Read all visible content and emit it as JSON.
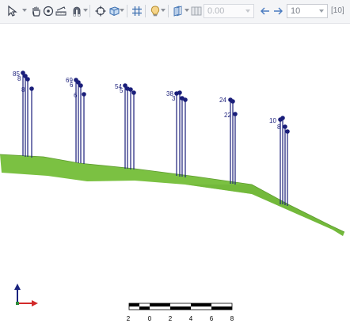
{
  "toolbar": {
    "tools": [
      {
        "name": "select-tool-icon"
      },
      {
        "name": "pan-tool-icon"
      },
      {
        "name": "zoom-target-icon"
      },
      {
        "name": "measure-ruler-icon"
      },
      {
        "name": "magnet-snap-icon"
      },
      {
        "name": "crosshair-center-icon"
      },
      {
        "name": "cube-view-icon"
      },
      {
        "name": "grid-icon"
      },
      {
        "name": "lightbulb-icon"
      },
      {
        "name": "layers-icon"
      },
      {
        "name": "columns-view-icon"
      }
    ],
    "value_input": "0.00",
    "zoom_value": "10",
    "zoom_count": "[10]"
  },
  "scene": {
    "terrain_color": "#7bc142",
    "marker_color": "#1a1e7a",
    "point_labels": [
      "85",
      "69",
      "54",
      "38",
      "24",
      "22",
      "10",
      "8"
    ]
  },
  "axes": {
    "x_color": "#d22a2a",
    "y_color": "#1a237e"
  },
  "scale_bar": {
    "ticks": [
      "2",
      "0",
      "2",
      "4",
      "6",
      "8"
    ]
  }
}
